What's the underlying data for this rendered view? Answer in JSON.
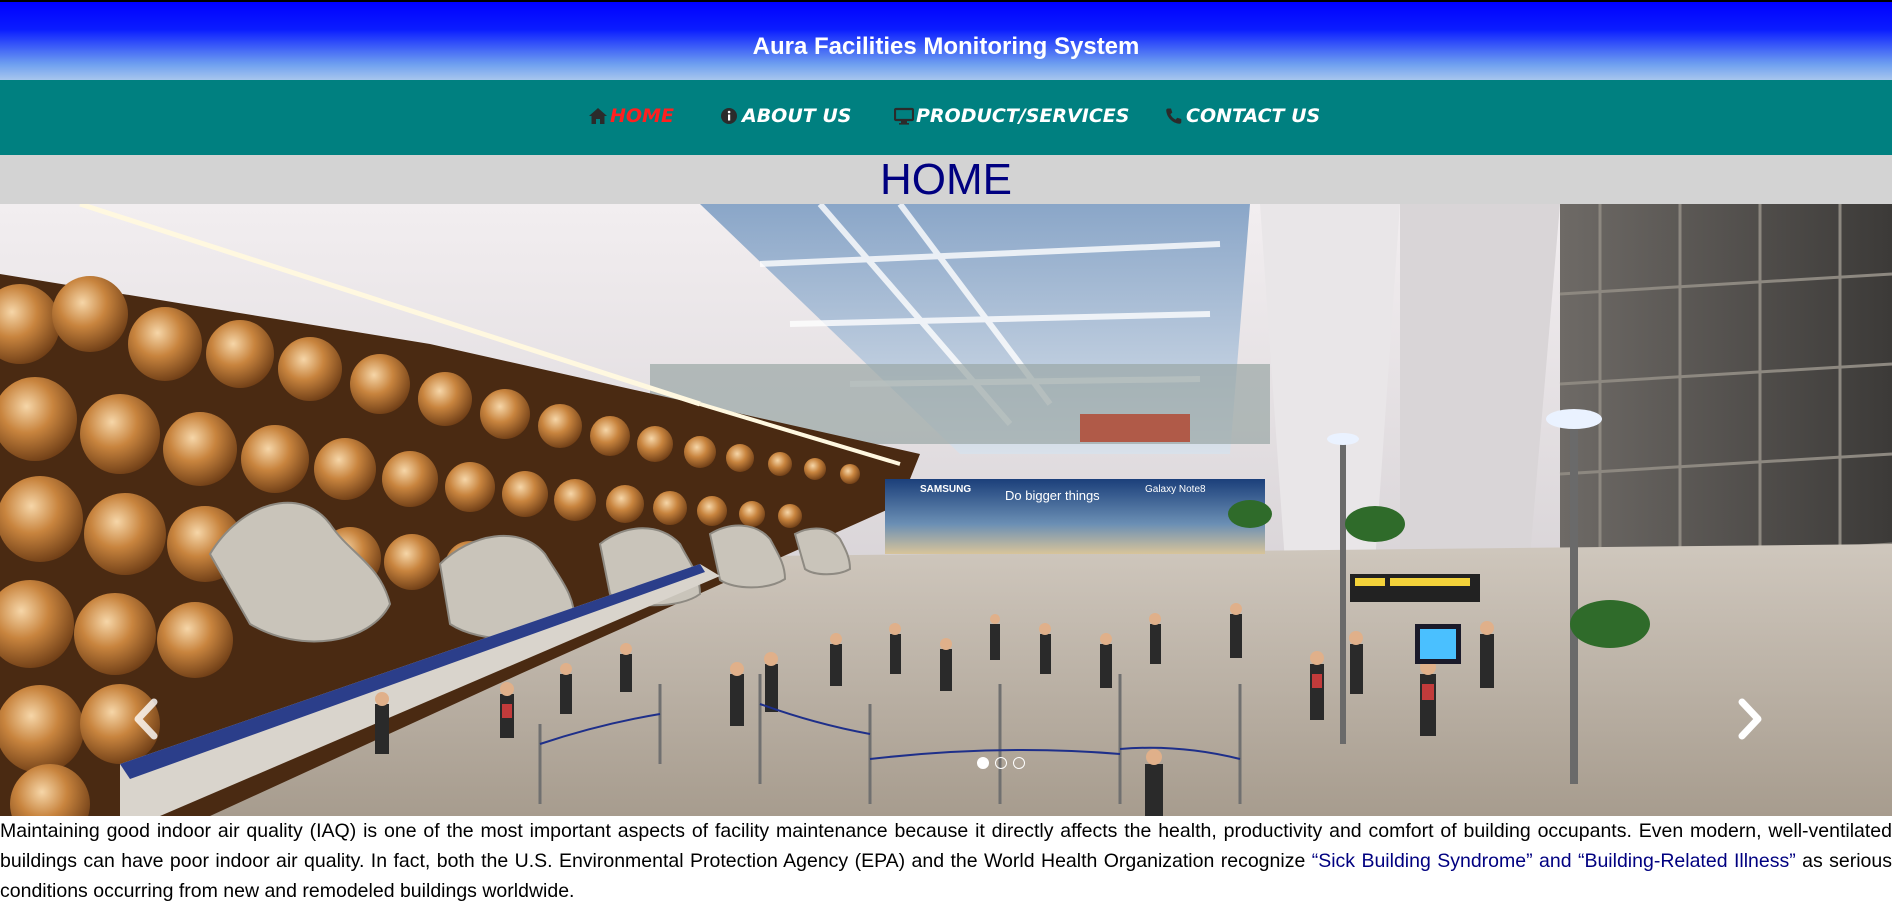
{
  "header": {
    "title": "Aura Facilities Monitoring System"
  },
  "nav": {
    "items": [
      {
        "label": "HOME",
        "icon": "home-icon",
        "active": true
      },
      {
        "label": "ABOUT US",
        "icon": "info-icon",
        "active": false
      },
      {
        "label": "PRODUCT/SERVICES",
        "icon": "monitor-icon",
        "active": false
      },
      {
        "label": "CONTACT US",
        "icon": "phone-icon",
        "active": false
      }
    ]
  },
  "page": {
    "heading": "HOME"
  },
  "carousel": {
    "slide_count": 3,
    "active_index": 0,
    "banner_brand": "SAMSUNG",
    "banner_tagline": "Do bigger things",
    "banner_product": "Galaxy Note8",
    "prev_icon": "chevron-left-icon",
    "next_icon": "chevron-right-icon"
  },
  "content": {
    "text_1": "Maintaining good indoor air quality (IAQ) is one of the most important aspects of facility maintenance because it directly affects the health, productivity and comfort of building occupants. Even modern, well-ventilated buildings can have poor indoor air quality. In fact, both the U.S. Environmental Protection Agency (EPA) and the World Health Organization recognize ",
    "highlight": "“Sick Building Syndrome” and “Building-Related Illness”",
    "text_2": " as serious conditions occurring from new and remodeled buildings worldwide."
  },
  "colors": {
    "header_top": "#0000ff",
    "nav_bg": "#008080",
    "active_nav": "#ff2020",
    "heading": "#000080",
    "band_bg": "#d3d3d3"
  }
}
